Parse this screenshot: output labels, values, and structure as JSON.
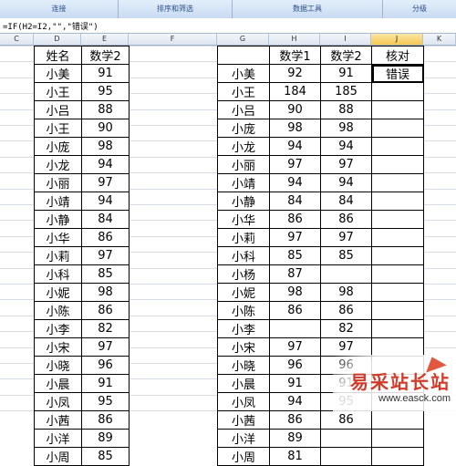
{
  "ribbon": {
    "groups": [
      "连接",
      "排序和筛选",
      "数据工具",
      "分级"
    ]
  },
  "formula_bar": {
    "formula": "=IF(H2=I2,\"\",\"错误\")"
  },
  "columns": [
    "C",
    "D",
    "E",
    "F",
    "G",
    "H",
    "I",
    "J",
    "K"
  ],
  "active_column": "J",
  "table_left": {
    "headers": [
      "姓名",
      "数学2"
    ],
    "rows": [
      [
        "小美",
        "91"
      ],
      [
        "小王",
        "95"
      ],
      [
        "小吕",
        "88"
      ],
      [
        "小王",
        "90"
      ],
      [
        "小庞",
        "98"
      ],
      [
        "小龙",
        "94"
      ],
      [
        "小丽",
        "97"
      ],
      [
        "小靖",
        "94"
      ],
      [
        "小静",
        "84"
      ],
      [
        "小华",
        "86"
      ],
      [
        "小莉",
        "97"
      ],
      [
        "小科",
        "85"
      ],
      [
        "小妮",
        "98"
      ],
      [
        "小陈",
        "86"
      ],
      [
        "小李",
        "82"
      ],
      [
        "小宋",
        "97"
      ],
      [
        "小晓",
        "96"
      ],
      [
        "小晨",
        "91"
      ],
      [
        "小凤",
        "95"
      ],
      [
        "小茜",
        "86"
      ],
      [
        "小洋",
        "89"
      ],
      [
        "小周",
        "85"
      ]
    ]
  },
  "table_right": {
    "headers": [
      "",
      "数学1",
      "数学2",
      "核对"
    ],
    "rows": [
      [
        "小美",
        "92",
        "91",
        "错误"
      ],
      [
        "小王",
        "184",
        "185",
        ""
      ],
      [
        "小吕",
        "90",
        "88",
        ""
      ],
      [
        "小庞",
        "98",
        "98",
        ""
      ],
      [
        "小龙",
        "94",
        "94",
        ""
      ],
      [
        "小丽",
        "97",
        "97",
        ""
      ],
      [
        "小靖",
        "94",
        "94",
        ""
      ],
      [
        "小静",
        "84",
        "84",
        ""
      ],
      [
        "小华",
        "86",
        "86",
        ""
      ],
      [
        "小莉",
        "97",
        "97",
        ""
      ],
      [
        "小科",
        "85",
        "85",
        ""
      ],
      [
        "小杨",
        "87",
        "",
        ""
      ],
      [
        "小妮",
        "98",
        "98",
        ""
      ],
      [
        "小陈",
        "86",
        "86",
        ""
      ],
      [
        "小李",
        "",
        "82",
        ""
      ],
      [
        "小宋",
        "97",
        "97",
        ""
      ],
      [
        "小晓",
        "96",
        "96",
        ""
      ],
      [
        "小晨",
        "91",
        "91",
        ""
      ],
      [
        "小凤",
        "94",
        "95",
        ""
      ],
      [
        "小茜",
        "86",
        "86",
        ""
      ],
      [
        "小洋",
        "89",
        "",
        ""
      ],
      [
        "小周",
        "81",
        "",
        ""
      ]
    ]
  },
  "watermark": {
    "title": "易采站长站",
    "url": "www.easck.com"
  }
}
